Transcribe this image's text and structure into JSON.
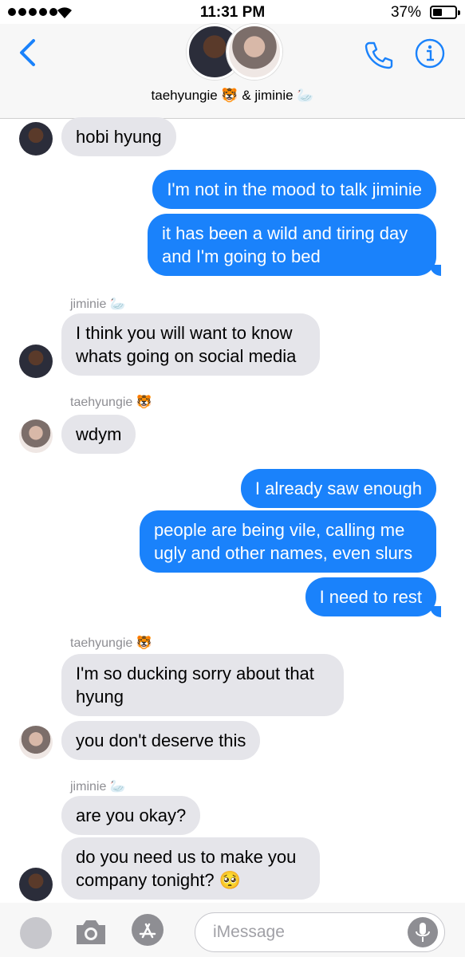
{
  "status_bar": {
    "time": "11:31 PM",
    "battery": "37%",
    "battery_level": 0.37
  },
  "header": {
    "group_name": "taehyungie 🐯 & jiminie 🦢",
    "back_icon": "chevron-left-icon",
    "call_icon": "phone-icon",
    "info_icon": "info-icon"
  },
  "messages": [
    {
      "dir": "in",
      "text": "hobi hyung"
    },
    {
      "dir": "out",
      "text": "I'm not in the mood to talk jiminie"
    },
    {
      "dir": "out",
      "text": "it has been a wild and tiring day and I'm going to bed"
    },
    {
      "dir": "in",
      "sender": "jiminie 🦢",
      "text": "I think you will want to know whats going on social media"
    },
    {
      "dir": "in",
      "sender": "taehyungie 🐯",
      "text": "wdym"
    },
    {
      "dir": "out",
      "text": "I already saw enough"
    },
    {
      "dir": "out",
      "text": "people are being vile, calling me ugly and other names, even slurs"
    },
    {
      "dir": "out",
      "text": "I need to rest"
    },
    {
      "dir": "in",
      "sender": "taehyungie 🐯",
      "text": "I'm so ducking sorry about that hyung"
    },
    {
      "dir": "in",
      "text": "you don't deserve this"
    },
    {
      "dir": "in",
      "sender": "jiminie 🦢",
      "text": "are you okay?"
    },
    {
      "dir": "in",
      "text": "do you need us to make you company tonight? 🥺"
    }
  ],
  "input": {
    "placeholder": "iMessage"
  },
  "colors": {
    "outgoing_bubble": "#1a82fb",
    "incoming_bubble": "#e5e5ea",
    "accent": "#1a82fb"
  }
}
